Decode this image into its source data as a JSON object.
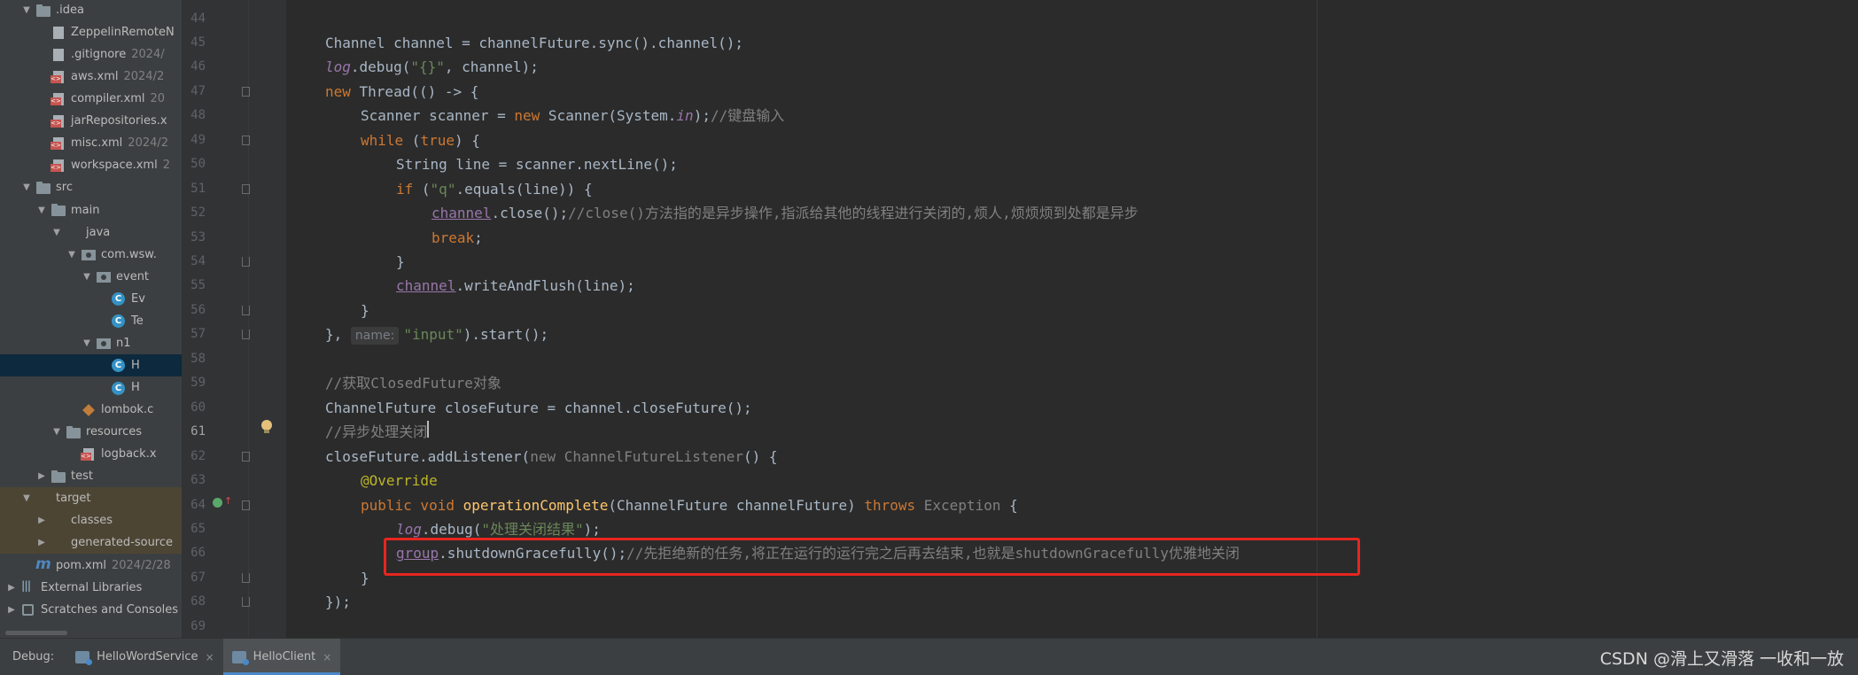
{
  "project_tree": [
    {
      "label": ".idea",
      "depth": 2,
      "arrow": "down",
      "icon": "folder",
      "top": 0
    },
    {
      "label": "ZeppelinRemoteN",
      "depth": 3,
      "arrow": "none",
      "icon": "file",
      "meta": ""
    },
    {
      "label": ".gitignore",
      "depth": 3,
      "arrow": "none",
      "icon": "file",
      "meta": "2024/"
    },
    {
      "label": "aws.xml",
      "depth": 3,
      "arrow": "none",
      "icon": "xml",
      "meta": "2024/2"
    },
    {
      "label": "compiler.xml",
      "depth": 3,
      "arrow": "none",
      "icon": "xml",
      "meta": "20"
    },
    {
      "label": "jarRepositories.x",
      "depth": 3,
      "arrow": "none",
      "icon": "xml",
      "meta": ""
    },
    {
      "label": "misc.xml",
      "depth": 3,
      "arrow": "none",
      "icon": "xml",
      "meta": "2024/2"
    },
    {
      "label": "workspace.xml",
      "depth": 3,
      "arrow": "none",
      "icon": "xml",
      "meta": "2"
    },
    {
      "label": "src",
      "depth": 2,
      "arrow": "down",
      "icon": "folder",
      "meta": ""
    },
    {
      "label": "main",
      "depth": 3,
      "arrow": "down",
      "icon": "folder",
      "meta": ""
    },
    {
      "label": "java",
      "depth": 4,
      "arrow": "down",
      "icon": "folder-blue",
      "meta": ""
    },
    {
      "label": "com.wsw.",
      "depth": 5,
      "arrow": "down",
      "icon": "package",
      "meta": ""
    },
    {
      "label": "event",
      "depth": 6,
      "arrow": "down",
      "icon": "package",
      "meta": ""
    },
    {
      "label": "Ev",
      "depth": 7,
      "arrow": "none",
      "icon": "class",
      "meta": ""
    },
    {
      "label": "Te",
      "depth": 7,
      "arrow": "none",
      "icon": "class",
      "meta": ""
    },
    {
      "label": "n1",
      "depth": 6,
      "arrow": "down",
      "icon": "package",
      "meta": ""
    },
    {
      "label": "H",
      "depth": 7,
      "arrow": "none",
      "icon": "class",
      "meta": "",
      "selected": true
    },
    {
      "label": "H",
      "depth": 7,
      "arrow": "none",
      "icon": "class",
      "meta": ""
    },
    {
      "label": "lombok.c",
      "depth": 5,
      "arrow": "none",
      "icon": "jar",
      "meta": ""
    },
    {
      "label": "resources",
      "depth": 4,
      "arrow": "down",
      "icon": "folder",
      "meta": ""
    },
    {
      "label": "logback.x",
      "depth": 5,
      "arrow": "none",
      "icon": "xml",
      "meta": ""
    },
    {
      "label": "test",
      "depth": 3,
      "arrow": "right",
      "icon": "folder",
      "meta": ""
    },
    {
      "label": "target",
      "depth": 2,
      "arrow": "down",
      "icon": "folder-orange",
      "meta": "",
      "excluded": true
    },
    {
      "label": "classes",
      "depth": 3,
      "arrow": "right",
      "icon": "folder-orange",
      "meta": "",
      "excluded": true
    },
    {
      "label": "generated-source",
      "depth": 3,
      "arrow": "right",
      "icon": "folder-orange",
      "meta": "",
      "excluded": true
    },
    {
      "label": "pom.xml",
      "depth": 2,
      "arrow": "none",
      "icon": "maven",
      "meta": "2024/2/28"
    },
    {
      "label": "External Libraries",
      "depth": 1,
      "arrow": "right",
      "icon": "lib",
      "meta": ""
    },
    {
      "label": "Scratches and Consoles",
      "depth": 1,
      "arrow": "right",
      "icon": "scratch",
      "meta": ""
    }
  ],
  "editor": {
    "current_line": 61,
    "lines": [
      {
        "n": 44,
        "indent": 0,
        "code": []
      },
      {
        "n": 45,
        "indent": 0,
        "code": [
          [
            "",
            "Channel channel = channelFuture.sync().channel();"
          ]
        ]
      },
      {
        "n": 46,
        "indent": 0,
        "code": [
          [
            "fldi",
            "log"
          ],
          [
            "",
            ".debug("
          ],
          [
            "str",
            "\"{}\""
          ],
          [
            "",
            ", channel);"
          ]
        ]
      },
      {
        "n": 47,
        "indent": 0,
        "code": [
          [
            "kw",
            "new "
          ],
          [
            "",
            "Thread(() -> {"
          ]
        ]
      },
      {
        "n": 48,
        "indent": 1,
        "code": [
          [
            "",
            "Scanner scanner = "
          ],
          [
            "kw",
            "new "
          ],
          [
            "",
            "Scanner(System."
          ],
          [
            "fldi",
            "in"
          ],
          [
            "",
            ");"
          ],
          [
            "cm",
            "//键盘输入"
          ]
        ]
      },
      {
        "n": 49,
        "indent": 1,
        "code": [
          [
            "kw",
            "while "
          ],
          [
            "",
            "("
          ],
          [
            "kw",
            "true"
          ],
          [
            "",
            ") {"
          ]
        ]
      },
      {
        "n": 50,
        "indent": 2,
        "code": [
          [
            "",
            "String line = scanner.nextLine();"
          ]
        ]
      },
      {
        "n": 51,
        "indent": 2,
        "code": [
          [
            "kw",
            "if "
          ],
          [
            "",
            "("
          ],
          [
            "str",
            "\"q\""
          ],
          [
            "",
            ".equals(line)) {"
          ]
        ]
      },
      {
        "n": 52,
        "indent": 3,
        "code": [
          [
            "fld ul",
            "channel"
          ],
          [
            "",
            ".close();"
          ],
          [
            "cm",
            "//close()方法指的是异步操作,指派给其他的线程进行关闭的,烦人,烦烦烦到处都是异步"
          ]
        ]
      },
      {
        "n": 53,
        "indent": 3,
        "code": [
          [
            "kw",
            "break"
          ],
          [
            "",
            ";"
          ]
        ]
      },
      {
        "n": 54,
        "indent": 2,
        "code": [
          [
            "",
            "}"
          ]
        ]
      },
      {
        "n": 55,
        "indent": 2,
        "code": [
          [
            "fld ul",
            "channel"
          ],
          [
            "",
            ".writeAndFlush(line);"
          ]
        ]
      },
      {
        "n": 56,
        "indent": 1,
        "code": [
          [
            "",
            "}"
          ]
        ]
      },
      {
        "n": 57,
        "indent": 0,
        "code": [
          [
            "",
            "}, "
          ],
          [
            "hint",
            "name:"
          ],
          [
            "str",
            "\"input\""
          ],
          [
            "",
            ").start();"
          ]
        ]
      },
      {
        "n": 58,
        "indent": 0,
        "code": []
      },
      {
        "n": 59,
        "indent": 0,
        "code": [
          [
            "cm",
            "//获取ClosedFuture对象"
          ]
        ]
      },
      {
        "n": 60,
        "indent": 0,
        "code": [
          [
            "",
            "ChannelFuture closeFuture = channel.closeFuture();"
          ]
        ]
      },
      {
        "n": 61,
        "indent": 0,
        "code": [
          [
            "cm",
            "//异步处理关闭"
          ]
        ]
      },
      {
        "n": 62,
        "indent": 0,
        "code": [
          [
            "",
            "closeFuture.addListener("
          ],
          [
            "grey",
            "new ChannelFutureListener"
          ],
          [
            "",
            "() {"
          ]
        ]
      },
      {
        "n": 63,
        "indent": 1,
        "code": [
          [
            "ann",
            "@Override"
          ]
        ]
      },
      {
        "n": 64,
        "indent": 1,
        "code": [
          [
            "kw",
            "public void "
          ],
          [
            "mth",
            "operationComplete"
          ],
          [
            "",
            "(ChannelFuture channelFuture) "
          ],
          [
            "kw",
            "throws "
          ],
          [
            "grey",
            "Exception"
          ],
          [
            "",
            " {"
          ]
        ]
      },
      {
        "n": 65,
        "indent": 2,
        "code": [
          [
            "fldi",
            "log"
          ],
          [
            "",
            ".debug("
          ],
          [
            "str",
            "\"处理关闭结果\""
          ],
          [
            "",
            ");"
          ]
        ]
      },
      {
        "n": 66,
        "indent": 2,
        "code": [
          [
            "fld ul",
            "group"
          ],
          [
            "",
            ".shutdownGracefully();"
          ],
          [
            "cm",
            "//先拒绝新的任务,将正在运行的运行完之后再去结束,也就是shutdownGracefully优雅地关闭"
          ]
        ]
      },
      {
        "n": 67,
        "indent": 1,
        "code": [
          [
            "",
            "}"
          ]
        ]
      },
      {
        "n": 68,
        "indent": 0,
        "code": [
          [
            "",
            "});"
          ]
        ]
      },
      {
        "n": 69,
        "indent": 0,
        "code": []
      }
    ]
  },
  "bottom_bar": {
    "debug_label": "Debug:",
    "tabs": [
      {
        "label": "HelloWordService",
        "active": false
      },
      {
        "label": "HelloClient",
        "active": true
      }
    ],
    "close_glyph": "×"
  },
  "watermark": "CSDN @滑上又滑落 一收和一放",
  "colors": {
    "highlight_box": "#e6261f",
    "keyword": "#cc7832",
    "string": "#6a8759",
    "comment": "#808080",
    "field": "#9876aa"
  }
}
